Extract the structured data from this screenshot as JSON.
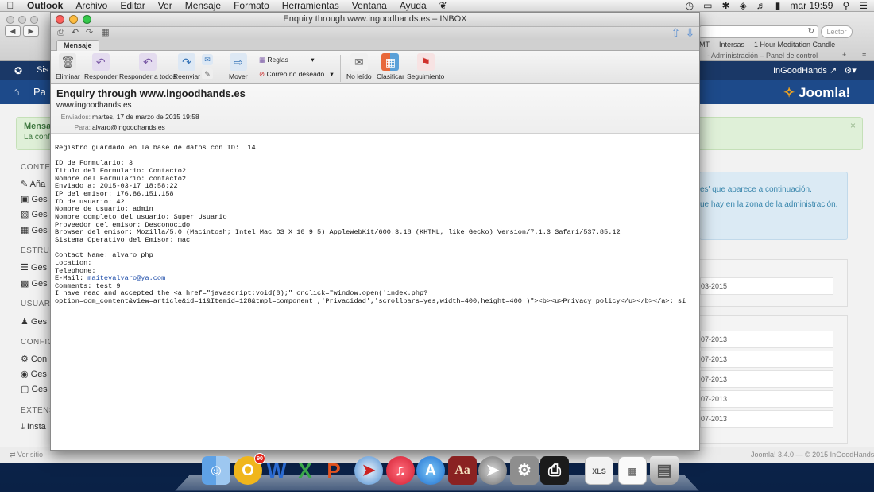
{
  "menubar": {
    "app": "Outlook",
    "items": [
      "Archivo",
      "Editar",
      "Ver",
      "Mensaje",
      "Formato",
      "Herramientas",
      "Ventana",
      "Ayuda"
    ],
    "clock": "mar 19:59"
  },
  "browser": {
    "search_placeholder": "Lector",
    "bookmarks": [
      "MT",
      "Intersas",
      "1 Hour Meditation Candle"
    ],
    "tab_title": "- Administración – Panel de control",
    "joomla": {
      "user_link": "InGoodHands",
      "header_title": "Pa",
      "logo_text": "Joomla!",
      "msg_title": "Mensa",
      "msg_text": "La confi",
      "side": {
        "content_heading": "CONTEN",
        "content_items": [
          "Aña",
          "Ges",
          "Ges",
          "Ges"
        ],
        "struct_heading": "ESTRUC",
        "struct_items": [
          "Ges",
          "Ges"
        ],
        "users_heading": "USUARI",
        "users_items": [
          "Ges"
        ],
        "config_heading": "CONFIG",
        "config_items": [
          "Con",
          "Ges",
          "Ges"
        ],
        "ext_heading": "EXTENS",
        "ext_items": [
          "Insta"
        ]
      },
      "info_line1": "es' que aparece a continuación.",
      "info_line2": "ue hay en la zona de la administración.",
      "panel1_rows": [
        "03-2015"
      ],
      "panel2_rows": [
        "07-2013",
        "07-2013",
        "07-2013",
        "07-2013",
        "07-2013"
      ],
      "footer_left": "Ver sitio",
      "footer_right": "Joomla! 3.4.0 — © 2015 InGoodHands"
    }
  },
  "window": {
    "title": "Enquiry through www.ingoodhands.es – INBOX",
    "tab": "Mensaje",
    "ribbon": {
      "delete": "Eliminar",
      "reply": "Responder",
      "reply_all": "Responder a todos",
      "forward": "Reenviar",
      "move": "Mover",
      "rules": "Reglas",
      "junk": "Correo no deseado",
      "unread": "No leído",
      "categorize": "Clasificar",
      "followup": "Seguimiento"
    },
    "header": {
      "subject": "Enquiry through www.ingoodhands.es",
      "from": "www.ingoodhands.es",
      "sent_label": "Enviados:",
      "sent_value": "martes, 17 de marzo de 2015 19:58",
      "to_label": "Para:",
      "to_value": "alvaro@ingoodhands.es"
    },
    "body": {
      "lines_a": [
        "Registro guardado en la base de datos con ID:  14",
        "",
        "ID de Formulario: 3",
        "Titulo del Formulario: Contacto2",
        "Nombre del Formulario: contacto2",
        "Enviado a: 2015-03-17 18:58:22",
        "IP del emisor: 176.86.151.158",
        "ID de usuario: 42",
        "Nombre de usuario: admin",
        "Nombre completo del usuario: Super Usuario",
        "Proveedor del emisor: Desconocido",
        "Browser del emisor: Mozilla/5.0 (Macintosh; Intel Mac OS X 10_9_5) AppleWebKit/600.3.18 (KHTML, like Gecko) Version/7.1.3 Safari/537.85.12",
        "Sistema Operativo del Emisor: mac",
        "",
        "Contact Name: alvaro php",
        "Location:",
        "Telephone:"
      ],
      "email_prefix": "E-Mail: ",
      "email_link": "maitevalvaro@ya.com",
      "lines_b": [
        "Comments: test 9",
        "I have read and accepted the <a href=\"javascript:void(0);\" onclick=\"window.open('index.php?",
        "option=com_content&view=article&id=11&Itemid=128&tmpl=component','Privacidad','scrollbars=yes,width=400,height=400')\"><b><u>Privacy policy</u></b></a>: sí"
      ]
    }
  },
  "dock": {
    "outlook_badge": "90"
  }
}
